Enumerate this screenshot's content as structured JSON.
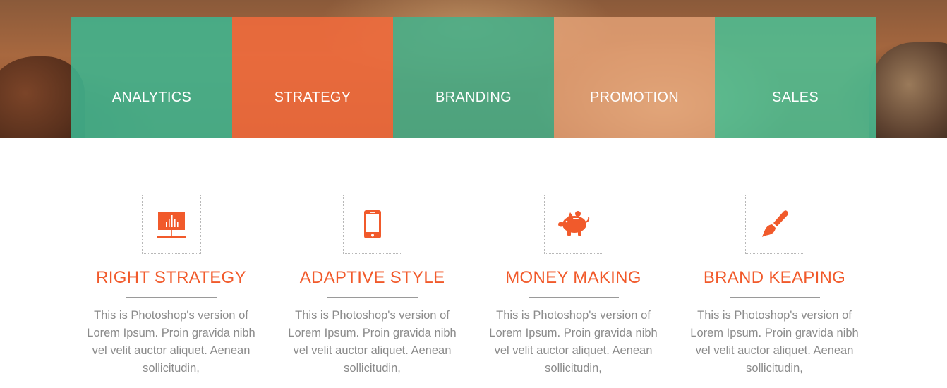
{
  "hero": {
    "tiles": [
      {
        "label": "ANALYTICS",
        "color": "#3fb58f"
      },
      {
        "label": "STRATEGY",
        "color": "#f26b3d"
      },
      {
        "label": "BRANDING",
        "color": "#3fb58f"
      },
      {
        "label": "PROMOTION",
        "color": "#e8a57a"
      },
      {
        "label": "SALES",
        "color": "#3fb58f"
      }
    ]
  },
  "features": [
    {
      "icon": "presentation-chart-icon",
      "title": "RIGHT STRATEGY",
      "text": "This is Photoshop's version of Lorem Ipsum. Proin gravida nibh vel velit auctor aliquet. Aenean sollicitudin,"
    },
    {
      "icon": "smartphone-icon",
      "title": "ADAPTIVE STYLE",
      "text": "This is Photoshop's version of Lorem Ipsum. Proin gravida nibh vel velit auctor aliquet. Aenean sollicitudin,"
    },
    {
      "icon": "piggy-bank-icon",
      "title": "MONEY MAKING",
      "text": "This is Photoshop's version of Lorem Ipsum. Proin gravida nibh vel velit auctor aliquet. Aenean sollicitudin,"
    },
    {
      "icon": "paint-brush-icon",
      "title": "BRAND KEAPING",
      "text": "This is Photoshop's version of Lorem Ipsum. Proin gravida nibh vel velit auctor aliquet. Aenean sollicitudin,"
    }
  ],
  "colors": {
    "accent": "#f15a2b",
    "green": "#3fb58f",
    "body_text": "#8b8b8b"
  }
}
